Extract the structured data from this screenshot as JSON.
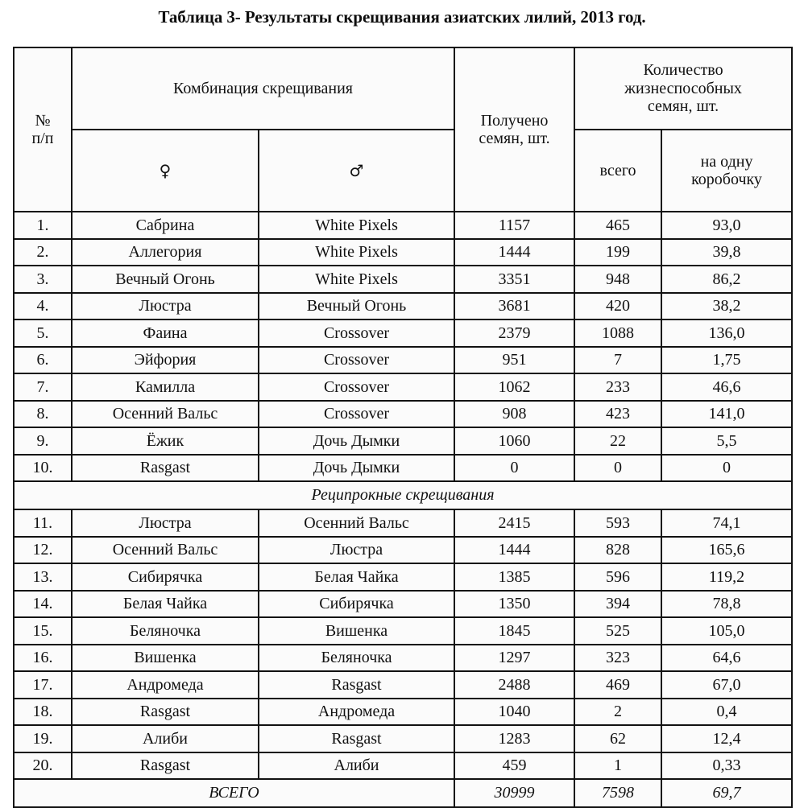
{
  "caption": "Таблица 3- Результаты скрещивания азиатских лилий, 2013 год.",
  "header": {
    "num": "№\nп/п",
    "num_line1": "№",
    "num_line2": "п/п",
    "combination": "Комбинация скрещивания",
    "female_symbol": "♀",
    "male_symbol": "♂",
    "obtained_seeds": "Получено\nсемян, шт.",
    "obtained_seeds_line1": "Получено",
    "obtained_seeds_line2": "семян, шт.",
    "viable_seeds": "Количество\nжизнеспособных\nсемян, шт.",
    "viable_seeds_line1": "Количество",
    "viable_seeds_line2": "жизнеспособных",
    "viable_seeds_line3": "семян, шт.",
    "total_sub": "всего",
    "per_capsule_sub": "на одну\nкоробочку",
    "per_capsule_sub_line1": "на одну",
    "per_capsule_sub_line2": "коробочку"
  },
  "section_label": "Реципрокные скрещивания",
  "total_label": "ВСЕГО",
  "colors": {
    "border": "#111111",
    "text": "#111111",
    "background": "#ffffff",
    "cell_background": "#fbfbfb"
  },
  "chart_data": {
    "type": "table",
    "title": "Таблица 3- Результаты скрещивания азиатских лилий, 2013 год.",
    "columns": [
      "№ п/п",
      "♀",
      "♂",
      "Получено семян, шт.",
      "всего",
      "на одну коробочку"
    ],
    "rows": [
      {
        "num": "1.",
        "female": "Сабрина",
        "male": "White Pixels",
        "obtained": "1157",
        "viable_total": "465",
        "per_capsule": "93,0"
      },
      {
        "num": "2.",
        "female": "Аллегория",
        "male": "White Pixels",
        "obtained": "1444",
        "viable_total": "199",
        "per_capsule": "39,8"
      },
      {
        "num": "3.",
        "female": "Вечный Огонь",
        "male": "White Pixels",
        "obtained": "3351",
        "viable_total": "948",
        "per_capsule": "86,2"
      },
      {
        "num": "4.",
        "female": "Люстра",
        "male": "Вечный Огонь",
        "obtained": "3681",
        "viable_total": "420",
        "per_capsule": "38,2"
      },
      {
        "num": "5.",
        "female": "Фаина",
        "male": "Crossover",
        "obtained": "2379",
        "viable_total": "1088",
        "per_capsule": "136,0"
      },
      {
        "num": "6.",
        "female": "Эйфория",
        "male": "Crossover",
        "obtained": "951",
        "viable_total": "7",
        "per_capsule": "1,75"
      },
      {
        "num": "7.",
        "female": "Камилла",
        "male": "Crossover",
        "obtained": "1062",
        "viable_total": "233",
        "per_capsule": "46,6"
      },
      {
        "num": "8.",
        "female": "Осенний Вальс",
        "male": "Crossover",
        "obtained": "908",
        "viable_total": "423",
        "per_capsule": "141,0"
      },
      {
        "num": "9.",
        "female": "Ёжик",
        "male": "Дочь Дымки",
        "obtained": "1060",
        "viable_total": "22",
        "per_capsule": "5,5"
      },
      {
        "num": "10.",
        "female": "Rasgast",
        "male": "Дочь Дымки",
        "obtained": "0",
        "viable_total": "0",
        "per_capsule": "0"
      },
      {
        "num": "11.",
        "female": "Люстра",
        "male": "Осенний Вальс",
        "obtained": "2415",
        "viable_total": "593",
        "per_capsule": "74,1"
      },
      {
        "num": "12.",
        "female": "Осенний Вальс",
        "male": "Люстра",
        "obtained": "1444",
        "viable_total": "828",
        "per_capsule": "165,6"
      },
      {
        "num": "13.",
        "female": "Сибирячка",
        "male": "Белая Чайка",
        "obtained": "1385",
        "viable_total": "596",
        "per_capsule": "119,2"
      },
      {
        "num": "14.",
        "female": "Белая Чайка",
        "male": "Сибирячка",
        "obtained": "1350",
        "viable_total": "394",
        "per_capsule": "78,8"
      },
      {
        "num": "15.",
        "female": "Беляночка",
        "male": "Вишенка",
        "obtained": "1845",
        "viable_total": "525",
        "per_capsule": "105,0"
      },
      {
        "num": "16.",
        "female": "Вишенка",
        "male": "Беляночка",
        "obtained": "1297",
        "viable_total": "323",
        "per_capsule": "64,6"
      },
      {
        "num": "17.",
        "female": "Андромеда",
        "male": "Rasgast",
        "obtained": "2488",
        "viable_total": "469",
        "per_capsule": "67,0"
      },
      {
        "num": "18.",
        "female": "Rasgast",
        "male": "Андромеда",
        "obtained": "1040",
        "viable_total": "2",
        "per_capsule": "0,4"
      },
      {
        "num": "19.",
        "female": "Алиби",
        "male": "Rasgast",
        "obtained": "1283",
        "viable_total": "62",
        "per_capsule": "12,4"
      },
      {
        "num": "20.",
        "female": "Rasgast",
        "male": "Алиби",
        "obtained": "459",
        "viable_total": "1",
        "per_capsule": "0,33"
      }
    ],
    "section_break_after_row": 10,
    "section_break_label": "Реципрокные скрещивания",
    "totals": {
      "label": "ВСЕГО",
      "obtained": "30999",
      "viable_total": "7598",
      "per_capsule": "69,7"
    }
  }
}
